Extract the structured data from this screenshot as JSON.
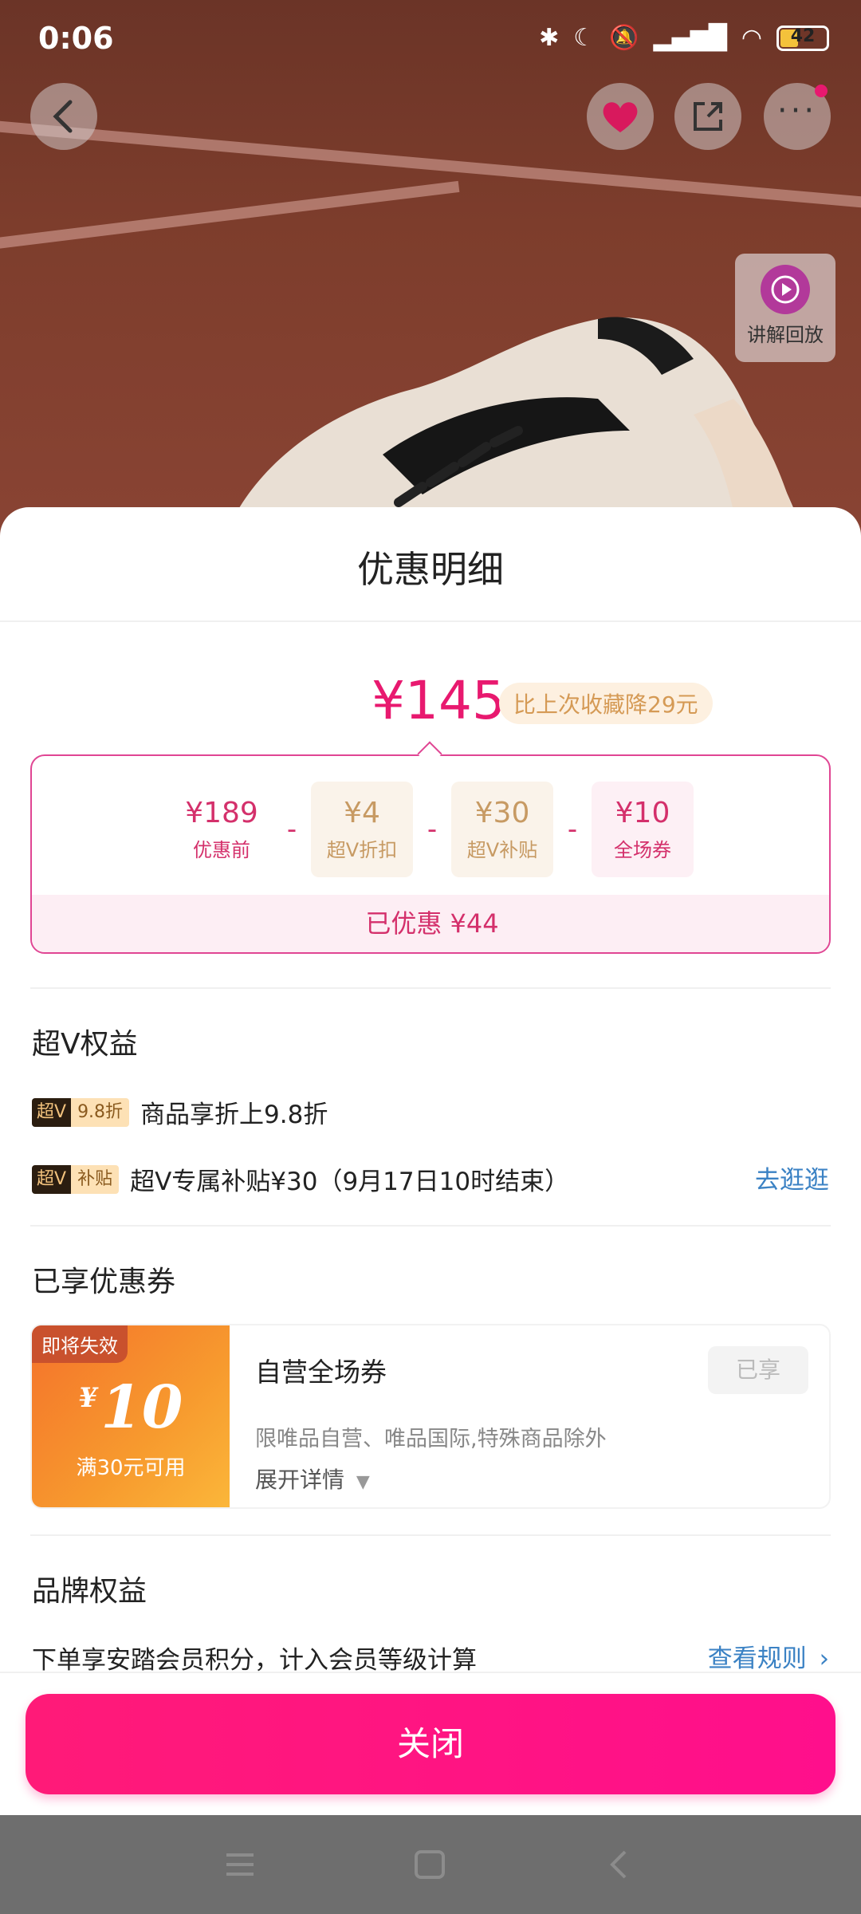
{
  "status_bar": {
    "time": "0:06",
    "battery": "42"
  },
  "replay": {
    "label": "讲解回放"
  },
  "sheet": {
    "title": "优惠明细",
    "final_price": "¥145",
    "price_drop_badge": "比上次收藏降29元",
    "breakdown": {
      "original": {
        "value": "¥189",
        "label": "优惠前"
      },
      "items": [
        {
          "value": "¥4",
          "label": "超V折扣"
        },
        {
          "value": "¥30",
          "label": "超V补贴"
        },
        {
          "value": "¥10",
          "label": "全场券"
        }
      ],
      "minus": "-",
      "saved_total": "已优惠 ¥44"
    },
    "super_v": {
      "title": "超V权益",
      "benefits": [
        {
          "tag_a": "超V",
          "tag_b": "9.8折",
          "text": "商品享折上9.8折"
        },
        {
          "tag_a": "超V",
          "tag_b": "补贴",
          "text": "超V专属补贴¥30（9月17日10时结束）",
          "link": "去逛逛"
        }
      ]
    },
    "coupons": {
      "title": "已享优惠券",
      "coupon": {
        "badge": "即将失效",
        "currency": "¥",
        "amount": "10",
        "condition": "满30元可用",
        "name": "自营全场券",
        "description": "限唯品自营、唯品国际,特殊商品除外",
        "expand": "展开详情",
        "status": "已享"
      }
    },
    "brand": {
      "title": "品牌权益",
      "text": "下单享安踏会员积分，计入会员等级计算",
      "link": "查看规则"
    },
    "close_label": "关闭"
  },
  "colors": {
    "accent": "#e8196f",
    "gold": "#c79a63",
    "link": "#3b82c4"
  }
}
